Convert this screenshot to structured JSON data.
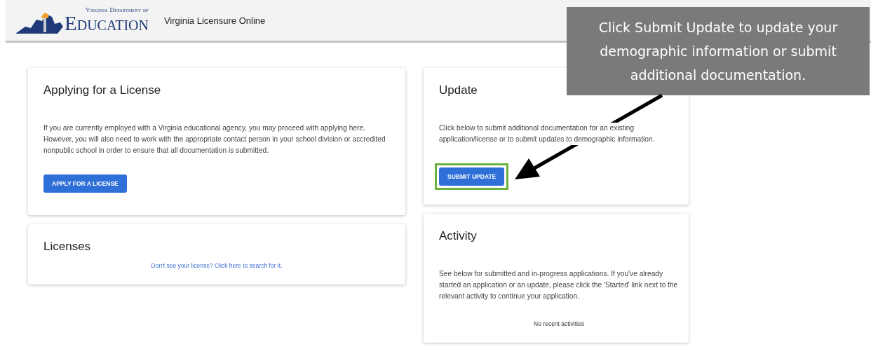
{
  "header": {
    "logo_top": "Virginia Department of",
    "logo_main": "Education",
    "app_title": "Virginia Licensure Online"
  },
  "left_cards": [
    {
      "kind": "button",
      "title": "Applying for a License",
      "text": "If you are currently employed with a Virginia educational agency, you may proceed with applying here. However, you will also need to work with the appropriate contact person in your school division or accredited nonpublic school in order to ensure that all documentation is submitted.",
      "button": "APPLY FOR A LICENSE",
      "highlighted": false
    },
    {
      "kind": "link",
      "title": "Licenses",
      "link": "Don't see your license? Click here to search for it."
    }
  ],
  "right_cards": [
    {
      "kind": "button",
      "title": "Update",
      "text": "Click below to submit additional documentation for an existing application/license or to submit updates to demographic information.",
      "button": "SUBMIT UPDATE",
      "highlighted": true
    },
    {
      "kind": "note",
      "title": "Activity",
      "text": "See below for submitted and in-progress applications. If you've already started an application or an update, please click the 'Started' link next to the relevant activity to continue your application.",
      "note": "No recent activities"
    }
  ],
  "callout": {
    "text": "Click Submit Update to update your demographic information or submit additional documentation."
  }
}
